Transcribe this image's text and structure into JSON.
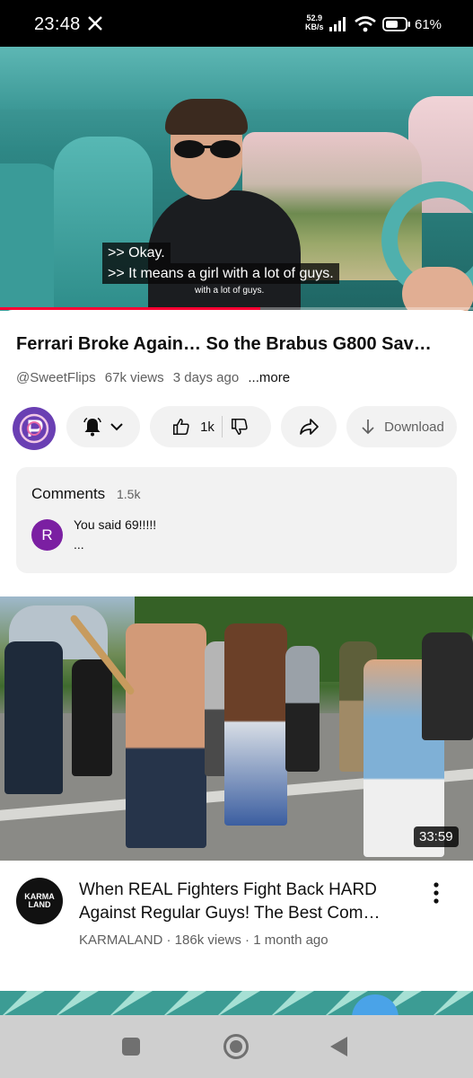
{
  "status_bar": {
    "time": "23:48",
    "net_speed_value": "52.9",
    "net_speed_unit": "KB/s",
    "battery_pct": "61%"
  },
  "player": {
    "captions": [
      ">> Okay.",
      ">> It means a girl with a lot of guys."
    ],
    "caption_echo": "with a lot of guys.",
    "progress": 0.55
  },
  "video": {
    "title": "Ferrari Broke Again… So the Brabus G800 Sav…",
    "channel": "@SweetFlips",
    "views": "67k views",
    "age": "3 days ago",
    "more_label": "...more"
  },
  "actions": {
    "like_count": "1k",
    "download_label": "Download"
  },
  "comments": {
    "title": "Comments",
    "count": "1.5k",
    "top_comment": {
      "avatar_letter": "R",
      "text": "You said 69!!!!!",
      "ellipsis": "..."
    }
  },
  "next_video": {
    "duration": "33:59",
    "channel_avatar_text": "KARMA LAND",
    "title_line1": "When REAL Fighters Fight Back HARD",
    "title_line2": "Against Regular Guys! The Best Com…",
    "meta": "KARMALAND · 186k views · 1 month ago"
  },
  "colors": {
    "progress_red": "#ff0033",
    "chip_bg": "#f2f2f2",
    "secondary_text": "#606060",
    "comment_avatar": "#7b1fa2"
  },
  "icons": [
    "x-logo-icon",
    "signal-icon",
    "wifi-icon",
    "battery-icon",
    "bell-icon",
    "chevron-down-icon",
    "thumbs-up-icon",
    "thumbs-down-icon",
    "share-icon",
    "download-icon",
    "more-vert-icon",
    "nav-recents-icon",
    "nav-home-icon",
    "nav-back-icon"
  ]
}
